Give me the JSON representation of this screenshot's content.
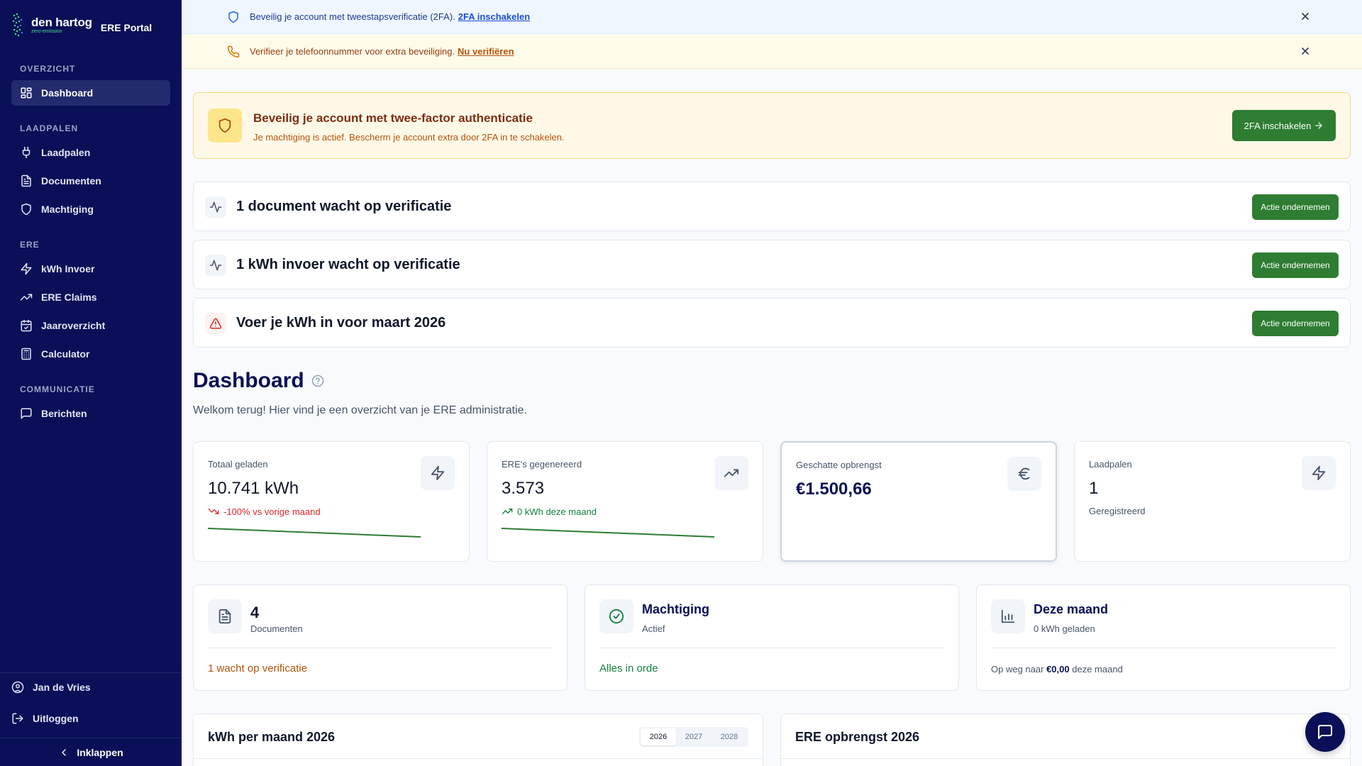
{
  "brand": {
    "name": "den hartog",
    "tagline": "zero-emission",
    "portal": "ERE Portal",
    "accent": "#4ade80"
  },
  "sidebar": {
    "sections": [
      {
        "title": "OVERZICHT",
        "items": [
          {
            "label": "Dashboard",
            "icon": "dashboard-icon",
            "active": true
          }
        ]
      },
      {
        "title": "LAADPALEN",
        "items": [
          {
            "label": "Laadpalen",
            "icon": "plug-icon"
          },
          {
            "label": "Documenten",
            "icon": "document-icon"
          },
          {
            "label": "Machtiging",
            "icon": "shield-icon"
          }
        ]
      },
      {
        "title": "ERE",
        "items": [
          {
            "label": "kWh Invoer",
            "icon": "bolt-icon"
          },
          {
            "label": "ERE Claims",
            "icon": "trending-up-icon"
          },
          {
            "label": "Jaaroverzicht",
            "icon": "calendar-check-icon"
          },
          {
            "label": "Calculator",
            "icon": "calculator-icon"
          }
        ]
      },
      {
        "title": "COMMUNICATIE",
        "items": [
          {
            "label": "Berichten",
            "icon": "message-icon"
          }
        ]
      }
    ],
    "user": "Jan de Vries",
    "logout": "Uitloggen",
    "collapse": "Inklappen"
  },
  "banners": {
    "twofa": {
      "text": "Beveilig je account met tweestapsverificatie (2FA).",
      "link": "2FA inschakelen"
    },
    "phone": {
      "text": "Verifieer je telefoonnummer voor extra beveiliging.",
      "link": "Nu verifiëren"
    }
  },
  "twofa_card": {
    "title": "Beveilig je account met twee-factor authenticatie",
    "subtitle": "Je machtiging is actief. Bescherm je account extra door 2FA in te schakelen.",
    "button": "2FA inschakelen"
  },
  "actions": [
    {
      "title": "1 document wacht op verificatie",
      "button": "Actie ondernemen",
      "icon": "activity-icon"
    },
    {
      "title": "1 kWh invoer wacht op verificatie",
      "button": "Actie ondernemen",
      "icon": "activity-icon"
    },
    {
      "title": "Voer je kWh in voor maart 2026",
      "button": "Actie ondernemen",
      "icon": "alert-triangle-icon"
    }
  ],
  "dashboard": {
    "title": "Dashboard",
    "subtitle": "Welkom terug! Hier vind je een overzicht van je ERE administratie."
  },
  "stats": {
    "total": {
      "label": "Totaal geladen",
      "value": "10.741 kWh",
      "delta": "-100% vs vorige maand"
    },
    "ere": {
      "label": "ERE's gegenereerd",
      "value": "3.573",
      "delta": "0 kWh deze maand"
    },
    "revenue": {
      "label": "Geschatte opbrengst",
      "value": "€1.500,66"
    },
    "chargers": {
      "label": "Laadpalen",
      "value": "1",
      "note": "Geregistreerd"
    }
  },
  "cards": {
    "documents": {
      "count": "4",
      "label": "Documenten",
      "footer": "1 wacht op verificatie"
    },
    "authorization": {
      "title": "Machtiging",
      "status": "Actief",
      "footer": "Alles in orde"
    },
    "month": {
      "title": "Deze maand",
      "sub": "0 kWh geladen",
      "footer_prefix": "Op weg naar",
      "footer_amount": "€0,00",
      "footer_suffix": "deze maand"
    }
  },
  "charts": {
    "kwh": {
      "title": "kWh per maand 2026",
      "years": [
        "2026",
        "2027",
        "2028"
      ],
      "selected": "2026"
    },
    "revenue": {
      "title": "ERE opbrengst 2026"
    }
  },
  "colors": {
    "sidebar": "#0a0f57",
    "primary_button": "#2e7d32",
    "warning": "#b45309",
    "danger": "#dc2626",
    "success": "#15803d"
  }
}
